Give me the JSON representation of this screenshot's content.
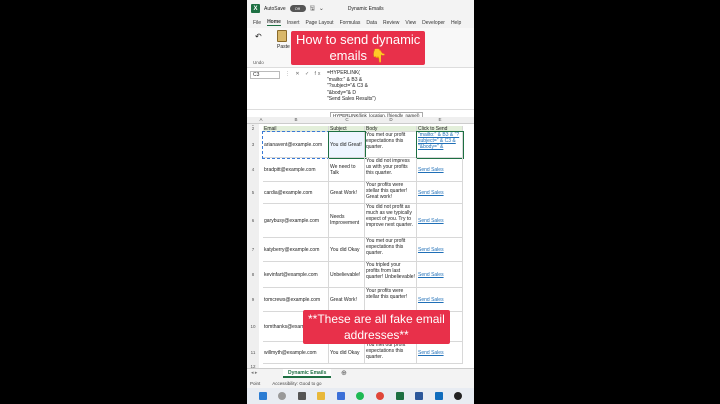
{
  "titlebar": {
    "logo": "X",
    "autosave_label": "AutoSave",
    "toggle_label": "Off",
    "doc_title": "Dynamic Emails",
    "save_icon": "save-icon"
  },
  "tabs": [
    "File",
    "Home",
    "Insert",
    "Page Layout",
    "Formulas",
    "Data",
    "Review",
    "View",
    "Developer",
    "Help"
  ],
  "ribbon": {
    "undo_label": "Undo",
    "paste_label": "Paste",
    "clipboard_label": "Clipboard",
    "format_painter": "Format Painter"
  },
  "captions": {
    "top": "How to send dynamic\nemails 👇",
    "bottom": "**These are all fake email\naddresses**"
  },
  "formula_bar": {
    "name_box": "C3",
    "fx_icons": "⋮ ✕ ✓ fx",
    "lines": [
      "=HYPERLINK(",
      "\"mailto:\" & B3 &",
      "\"?subject=\"& C3 &",
      "\"&body=\"& D",
      "\"Send Sales Results\")"
    ],
    "tooltip": "HYPERLINK(link_location, [friendly_name])"
  },
  "columns": [
    "A",
    "B",
    "C",
    "D",
    "E"
  ],
  "rows": [
    "1",
    "2",
    "3",
    "4",
    "5",
    "6",
    "7",
    "8",
    "9",
    "10",
    "11",
    "12"
  ],
  "table": {
    "headers": [
      "Email",
      "Subject",
      "Body",
      "Click to Send Email"
    ],
    "rows": [
      {
        "email": "arianavent@example.com",
        "subject": "You did Great!",
        "body": "You met our profit expectations this quarter.",
        "link": "\"mailto:\" & B3 & \"?subject=\" & C3 & \"&body=\" &"
      },
      {
        "email": "bradpitt@example.com",
        "subject": "We need to Talk",
        "body": "You did not impress us with your profits this quarter.",
        "link": "Send Sales Results"
      },
      {
        "email": "cardia@example.com",
        "subject": "Great Work!",
        "body": "Your profits were stellar this quarter! Great work!",
        "link": "Send Sales Results"
      },
      {
        "email": "garybusy@example.com",
        "subject": "Needs Improvement",
        "body": "You did not profit as much as we typically expect of you. Try to improve next quarter.",
        "link": "Send Sales Results"
      },
      {
        "email": "katyberry@example.com",
        "subject": "You did Okay",
        "body": "You met our profit expectations this quarter.",
        "link": "Send Sales Results"
      },
      {
        "email": "kevinfart@example.com",
        "subject": "Unbelievable!",
        "body": "You tripled your profits from last quarter! Unbelievable!",
        "link": "Send Sales Results"
      },
      {
        "email": "tomcrews@example.com",
        "subject": "Great Work!",
        "body": "Your profits were stellar this quarter!",
        "link": "Send Sales Results"
      },
      {
        "email": "tomthanks@example.com",
        "subject": "",
        "body": "",
        "link": "Send Sales Results"
      },
      {
        "email": "willmyth@example.com",
        "subject": "You did Okay",
        "body": "You met our profit expectations this quarter.",
        "link": "Send Sales Results"
      }
    ]
  },
  "sheet_tab": "Dynamic Emails",
  "status": {
    "mode": "Point",
    "accessibility": "Accessibility: Good to go"
  },
  "taskbar_icons": [
    "windows-icon",
    "search-icon",
    "task-view-icon",
    "folder-icon",
    "store-icon",
    "spotify-icon",
    "chrome-icon",
    "excel-icon",
    "word-icon",
    "outlook-icon",
    "obs-icon"
  ]
}
